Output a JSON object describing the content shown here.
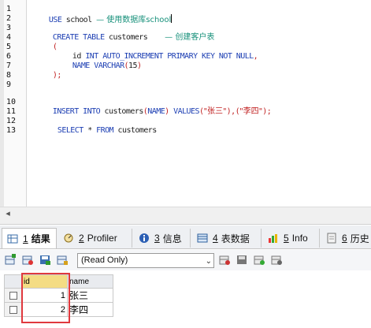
{
  "editor": {
    "line_numbers": [
      "1",
      "2",
      "3",
      "4",
      "5",
      "6",
      "7",
      "8",
      "9",
      "10",
      "11",
      "12",
      "13"
    ],
    "lines": {
      "l1_kw": "USE",
      "l1_id": " school ",
      "l1_cm": "— 使用数据库school",
      "l3_kw": "CREATE TABLE",
      "l3_id": " customers    ",
      "l3_cm": "— 创建客户表",
      "l4_pn": "(",
      "l5_id": "id",
      "l5_kw": " INT AUTO_INCREMENT PRIMARY KEY NOT NULL",
      "l5_pn": ",",
      "l6_id": "NAME",
      "l6_kw": " VARCHAR",
      "l6_pn1": "(",
      "l6_num": "15",
      "l6_pn2": ")",
      "l7_pn": ");",
      "l11_kw": "INSERT INTO",
      "l11_id": " customers",
      "l11_pn1": "(",
      "l11_id2": "NAME",
      "l11_pn2": ")",
      "l11_kw2": " VALUES",
      "l11_pn3": "(",
      "l11_str1": "\"张三\"",
      "l11_pn4": "),(",
      "l11_str2": "\"李四\"",
      "l11_pn5": ");",
      "l13_kw": "SELECT",
      "l13_pn": " * ",
      "l13_kw2": "FROM",
      "l13_id": " customers"
    }
  },
  "tabs": [
    {
      "num": "1",
      "label": "结果"
    },
    {
      "num": "2",
      "label": "Profiler"
    },
    {
      "num": "3",
      "label": "信息"
    },
    {
      "num": "4",
      "label": "表数据"
    },
    {
      "num": "5",
      "label": "Info"
    },
    {
      "num": "6",
      "label": "历史"
    }
  ],
  "toolbar": {
    "mode_select_value": "(Read Only)"
  },
  "grid": {
    "columns": [
      "id",
      "name"
    ],
    "rows": [
      {
        "id": "1",
        "name": "张三"
      },
      {
        "id": "2",
        "name": "李四"
      }
    ]
  },
  "colors": {
    "keyword": "#1d3fb3",
    "comment": "#16907a",
    "string": "#c02020",
    "highlight_box": "#e0393e"
  }
}
